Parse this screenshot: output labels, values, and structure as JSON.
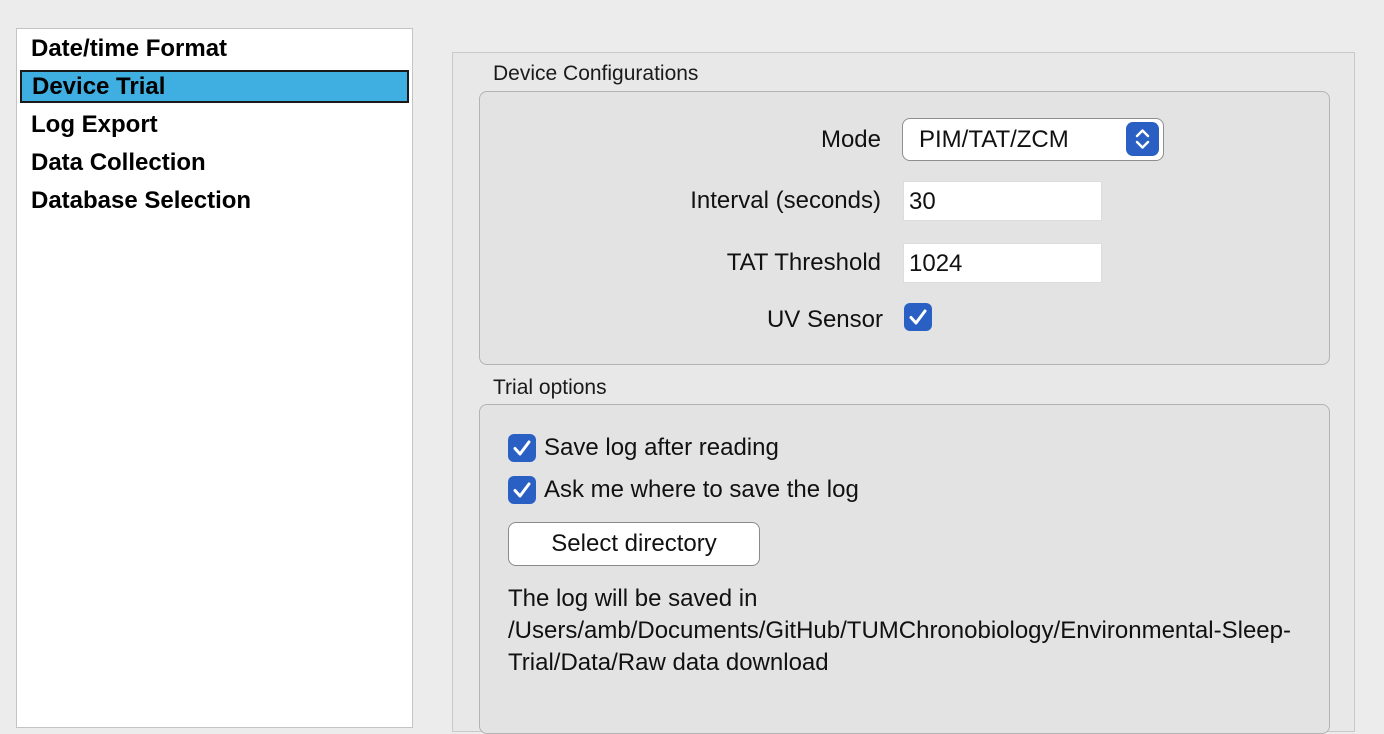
{
  "sidebar": {
    "items": [
      {
        "label": "Date/time Format",
        "selected": false
      },
      {
        "label": "Device Trial",
        "selected": true
      },
      {
        "label": "Log Export",
        "selected": false
      },
      {
        "label": "Data Collection",
        "selected": false
      },
      {
        "label": "Database Selection",
        "selected": false
      }
    ],
    "selected_color": "#3faee0"
  },
  "device_config": {
    "title": "Device Configurations",
    "mode_label": "Mode",
    "mode_value": "PIM/TAT/ZCM",
    "interval_label": "Interval (seconds)",
    "interval_value": "30",
    "tat_label": "TAT Threshold",
    "tat_value": "1024",
    "uv_label": "UV Sensor",
    "uv_checked": true
  },
  "trial_options": {
    "title": "Trial options",
    "save_log_label": "Save log after reading",
    "save_log_checked": true,
    "ask_where_label": "Ask me where to save the log",
    "ask_where_checked": true,
    "select_dir_label": "Select directory",
    "save_path_text": "The log will be saved in /Users/amb/Documents/GitHub/TUMChronobiology/Environmental-Sleep-Trial/Data/Raw data download"
  },
  "colors": {
    "accent": "#2a5fc4"
  },
  "icons": {
    "mode_stepper": "chevron-up-down-icon",
    "checkbox": "checkmark-icon"
  }
}
